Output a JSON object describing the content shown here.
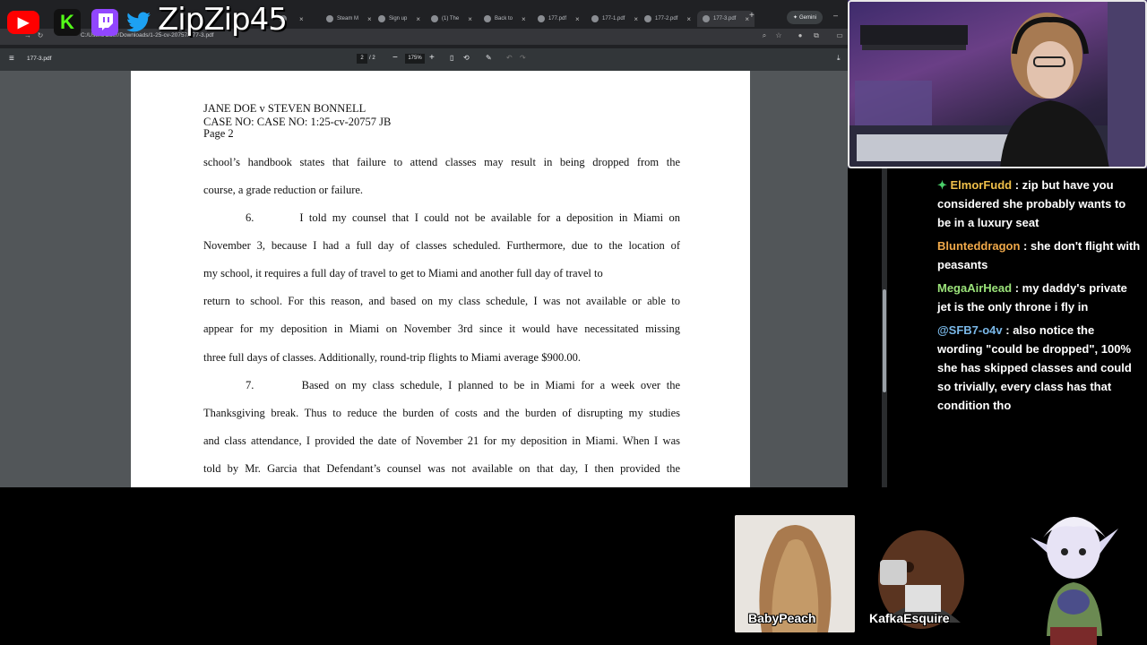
{
  "stream": {
    "channel_name": "ZipZip45",
    "social_icons": [
      "youtube-icon",
      "kick-icon",
      "twitch-icon",
      "twitter-icon"
    ]
  },
  "browser": {
    "tabs": [
      {
        "label": "",
        "active": false
      },
      {
        "label": "Steam M",
        "active": false
      },
      {
        "label": "Sign up",
        "active": false
      },
      {
        "label": "(1) The",
        "active": false
      },
      {
        "label": "Back to",
        "active": false
      },
      {
        "label": "177.pdf",
        "active": false
      },
      {
        "label": "177-1.pdf",
        "active": false
      },
      {
        "label": "177-2.pdf",
        "active": false
      },
      {
        "label": "177-3.pdf",
        "active": true
      }
    ],
    "gemini_label": "Gemini",
    "url": "C:/Users/Ober/Downloads/1-25-cv-20757/177-3.pdf"
  },
  "pdf_toolbar": {
    "file_name": "177-3.pdf",
    "current_page": "2",
    "total_pages": "/ 2",
    "zoom": "175%"
  },
  "document": {
    "header": {
      "case_title": "JANE DOE v STEVEN BONNELL",
      "case_no": "CASE NO: CASE NO: 1:25-cv-20757 JB",
      "page": "Page 2"
    },
    "lines": [
      {
        "text": "school’s handbook states that failure to attend classes may result in being dropped from the",
        "justify": true
      },
      {
        "text": "course, a grade reduction or failure.",
        "justify": false
      },
      {
        "text": "6.        I told my counsel that I could not be available for a deposition in Miami on",
        "justify": true
      },
      {
        "text": "November 3, because I had a full day of classes scheduled.  Furthermore, due to the location of",
        "justify": true
      },
      {
        "text": "my school, it requires a full day of travel to get to Miami and another full day of travel to",
        "justify": false
      },
      {
        "text": "return to school.  For this reason, and based on my class schedule, I was not available or able to",
        "justify": true
      },
      {
        "text": "appear for my deposition in Miami on November 3rd since it would have necessitated missing",
        "justify": true
      },
      {
        "text": "three full days of classes. Additionally, round-trip flights to Miami average $900.00.",
        "justify": false
      },
      {
        "text": "7.        Based on my class schedule, I planned to be in Miami for a week over the",
        "justify": true
      },
      {
        "text": "Thanksgiving break. Thus to reduce the burden of costs and the burden of disrupting my studies",
        "justify": true
      },
      {
        "text": "and class attendance, I provided the date of November 21 for my deposition in Miami. When I was",
        "justify": true
      },
      {
        "text": "told by Mr. Garcia that Defendant’s counsel was not available on that day, I then provided the",
        "justify": true
      }
    ]
  },
  "chat": [
    {
      "user": "ElmorFudd",
      "color": "#f0c04a",
      "badge": "diamond-icon",
      "text": " : zip but have you considered she probably wants to be in a luxury seat"
    },
    {
      "user": "Blunteddragon",
      "color": "#f0a94a",
      "badge": "",
      "text": " : she don't flight with peasants"
    },
    {
      "user": "MegaAirHead",
      "color": "#9be37a",
      "badge": "",
      "text": " : my daddy's private jet is the only throne i fly in"
    },
    {
      "user": "@SFB7-o4v",
      "color": "#7ab8e8",
      "badge": "",
      "text": " : also notice the wording \"could be dropped\", 100% she has skipped classes and could so trivially, every class has that condition tho"
    }
  ],
  "avatars": [
    {
      "name": "BabyPeach"
    },
    {
      "name": "KafkaEsquire"
    }
  ]
}
